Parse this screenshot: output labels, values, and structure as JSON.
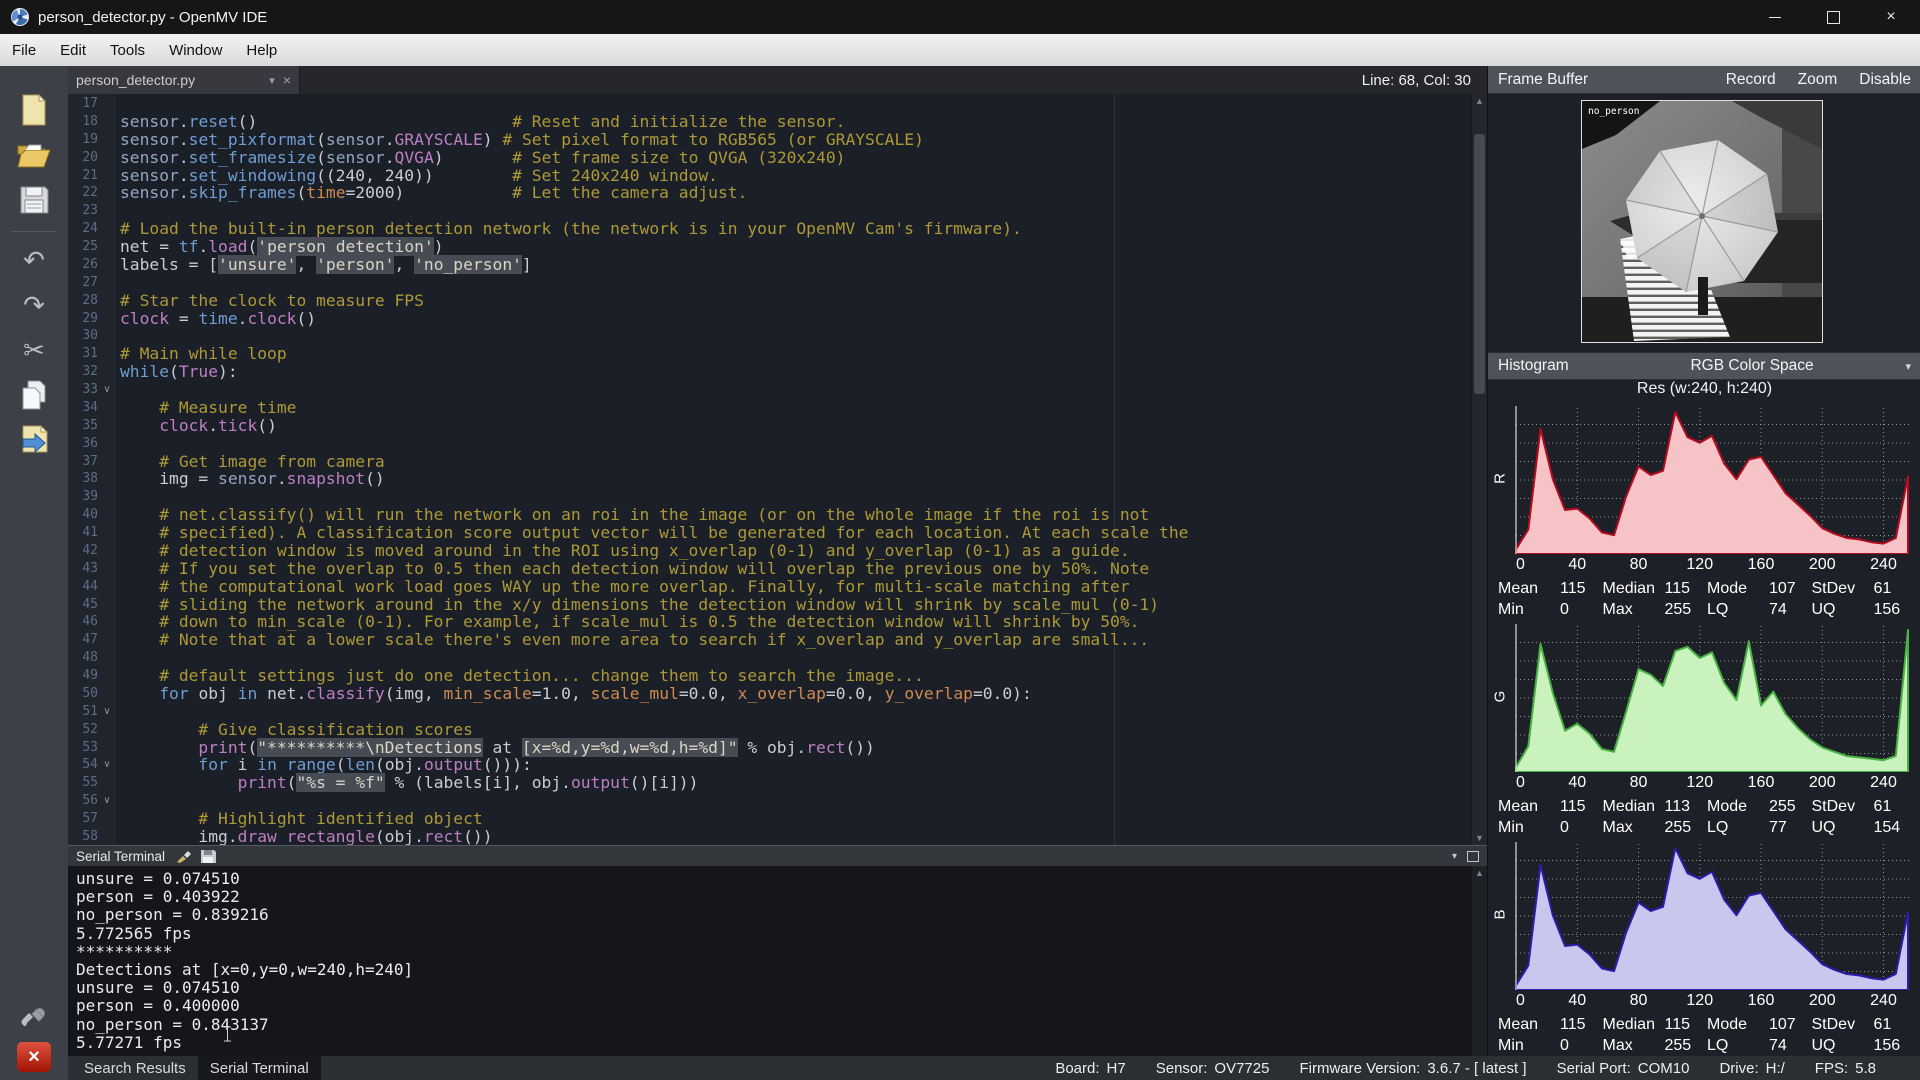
{
  "window": {
    "title": "person_detector.py - OpenMV IDE"
  },
  "menu": {
    "items": [
      "File",
      "Edit",
      "Tools",
      "Window",
      "Help"
    ]
  },
  "icons": {
    "close": "×",
    "dropdown": "▾",
    "undo": "↶",
    "redo": "↷",
    "cut": "✂",
    "scroll_up": "▲",
    "scroll_down": "▼",
    "fold": "∨",
    "collapse": "▾"
  },
  "editor": {
    "tab": {
      "label": "person_detector.py"
    },
    "cursor_status": "Line: 68, Col: 30",
    "lines": [
      {
        "n": 17,
        "seg": []
      },
      {
        "n": 18,
        "seg": [
          [
            "mod",
            "sensor"
          ],
          [
            "p",
            "."
          ],
          [
            "kb",
            "reset"
          ],
          [
            "p",
            "()                          "
          ],
          [
            "c",
            "# Reset and initialize the sensor."
          ]
        ]
      },
      {
        "n": 19,
        "seg": [
          [
            "mod",
            "sensor"
          ],
          [
            "p",
            "."
          ],
          [
            "kb",
            "set_pixformat"
          ],
          [
            "p",
            "("
          ],
          [
            "mod",
            "sensor"
          ],
          [
            "p",
            "."
          ],
          [
            "km",
            "GRAYSCALE"
          ],
          [
            "p",
            ") "
          ],
          [
            "c",
            "# Set pixel format to RGB565 (or GRAYSCALE)"
          ]
        ]
      },
      {
        "n": 20,
        "seg": [
          [
            "mod",
            "sensor"
          ],
          [
            "p",
            "."
          ],
          [
            "kb",
            "set_framesize"
          ],
          [
            "p",
            "("
          ],
          [
            "mod",
            "sensor"
          ],
          [
            "p",
            "."
          ],
          [
            "km",
            "QVGA"
          ],
          [
            "p",
            ")       "
          ],
          [
            "c",
            "# Set frame size to QVGA (320x240)"
          ]
        ]
      },
      {
        "n": 21,
        "seg": [
          [
            "mod",
            "sensor"
          ],
          [
            "p",
            "."
          ],
          [
            "kb",
            "set_windowing"
          ],
          [
            "p",
            "((240, 240))        "
          ],
          [
            "c",
            "# Set 240x240 window."
          ]
        ]
      },
      {
        "n": 22,
        "seg": [
          [
            "mod",
            "sensor"
          ],
          [
            "p",
            "."
          ],
          [
            "kb",
            "skip_frames"
          ],
          [
            "p",
            "("
          ],
          [
            "kw",
            "time"
          ],
          [
            "p",
            "=2000)           "
          ],
          [
            "c",
            "# Let the camera adjust."
          ]
        ]
      },
      {
        "n": 23,
        "seg": []
      },
      {
        "n": 24,
        "seg": [
          [
            "c",
            "# Load the built-in person detection network (the network is in your OpenMV Cam's firmware)."
          ]
        ]
      },
      {
        "n": 25,
        "seg": [
          [
            "p",
            "net = "
          ],
          [
            "kb",
            "tf"
          ],
          [
            "p",
            "."
          ],
          [
            "km",
            "load"
          ],
          [
            "p",
            "("
          ],
          [
            "s",
            "'person_detection'"
          ],
          [
            "p",
            ")"
          ]
        ]
      },
      {
        "n": 26,
        "seg": [
          [
            "p",
            "labels = ["
          ],
          [
            "s",
            "'unsure'"
          ],
          [
            "p",
            ", "
          ],
          [
            "s",
            "'person'"
          ],
          [
            "p",
            ", "
          ],
          [
            "s",
            "'no_person'"
          ],
          [
            "p",
            "]"
          ]
        ]
      },
      {
        "n": 27,
        "seg": []
      },
      {
        "n": 28,
        "seg": [
          [
            "c",
            "# Star the clock to measure FPS"
          ]
        ]
      },
      {
        "n": 29,
        "seg": [
          [
            "km",
            "clock"
          ],
          [
            "p",
            " = "
          ],
          [
            "kb",
            "time"
          ],
          [
            "p",
            "."
          ],
          [
            "km",
            "clock"
          ],
          [
            "p",
            "()"
          ]
        ]
      },
      {
        "n": 30,
        "seg": []
      },
      {
        "n": 31,
        "seg": [
          [
            "c",
            "# Main while loop"
          ]
        ]
      },
      {
        "n": 32,
        "seg": [
          [
            "kb",
            "while"
          ],
          [
            "p",
            "("
          ],
          [
            "km",
            "True"
          ],
          [
            "p",
            "):"
          ]
        ]
      },
      {
        "n": 33,
        "fold": true,
        "seg": []
      },
      {
        "n": 34,
        "seg": [
          [
            "p",
            "    "
          ],
          [
            "c",
            "# Measure time"
          ]
        ]
      },
      {
        "n": 35,
        "seg": [
          [
            "p",
            "    "
          ],
          [
            "km",
            "clock"
          ],
          [
            "p",
            "."
          ],
          [
            "km",
            "tick"
          ],
          [
            "p",
            "()"
          ]
        ]
      },
      {
        "n": 36,
        "seg": []
      },
      {
        "n": 37,
        "seg": [
          [
            "p",
            "    "
          ],
          [
            "c",
            "# Get image from camera"
          ]
        ]
      },
      {
        "n": 38,
        "seg": [
          [
            "p",
            "    img = "
          ],
          [
            "mod",
            "sensor"
          ],
          [
            "p",
            "."
          ],
          [
            "km",
            "snapshot"
          ],
          [
            "p",
            "()"
          ]
        ]
      },
      {
        "n": 39,
        "seg": []
      },
      {
        "n": 40,
        "seg": [
          [
            "p",
            "    "
          ],
          [
            "c",
            "# net.classify() will run the network on an roi in the image (or on the whole image if the roi is not"
          ]
        ]
      },
      {
        "n": 41,
        "seg": [
          [
            "p",
            "    "
          ],
          [
            "c",
            "# specified). A classification score output vector will be generated for each location. At each scale the"
          ]
        ]
      },
      {
        "n": 42,
        "seg": [
          [
            "p",
            "    "
          ],
          [
            "c",
            "# detection window is moved around in the ROI using x_overlap (0-1) and y_overlap (0-1) as a guide."
          ]
        ]
      },
      {
        "n": 43,
        "seg": [
          [
            "p",
            "    "
          ],
          [
            "c",
            "# If you set the overlap to 0.5 then each detection window will overlap the previous one by 50%. Note"
          ]
        ]
      },
      {
        "n": 44,
        "seg": [
          [
            "p",
            "    "
          ],
          [
            "c",
            "# the computational work load goes WAY up the more overlap. Finally, for multi-scale matching after"
          ]
        ]
      },
      {
        "n": 45,
        "seg": [
          [
            "p",
            "    "
          ],
          [
            "c",
            "# sliding the network around in the x/y dimensions the detection window will shrink by scale_mul (0-1)"
          ]
        ]
      },
      {
        "n": 46,
        "seg": [
          [
            "p",
            "    "
          ],
          [
            "c",
            "# down to min_scale (0-1). For example, if scale_mul is 0.5 the detection window will shrink by 50%."
          ]
        ]
      },
      {
        "n": 47,
        "seg": [
          [
            "p",
            "    "
          ],
          [
            "c",
            "# Note that at a lower scale there's even more area to search if x_overlap and y_overlap are small..."
          ]
        ]
      },
      {
        "n": 48,
        "seg": []
      },
      {
        "n": 49,
        "seg": [
          [
            "p",
            "    "
          ],
          [
            "c",
            "# default settings just do one detection... change them to search the image..."
          ]
        ]
      },
      {
        "n": 50,
        "seg": [
          [
            "p",
            "    "
          ],
          [
            "kb",
            "for"
          ],
          [
            "p",
            " obj "
          ],
          [
            "kb",
            "in"
          ],
          [
            "p",
            " net."
          ],
          [
            "km",
            "classify"
          ],
          [
            "p",
            "(img, "
          ],
          [
            "kw",
            "min_scale"
          ],
          [
            "p",
            "=1.0, "
          ],
          [
            "kw",
            "scale_mul"
          ],
          [
            "p",
            "=0.0, "
          ],
          [
            "kw",
            "x_overlap"
          ],
          [
            "p",
            "=0.0, "
          ],
          [
            "kw",
            "y_overlap"
          ],
          [
            "p",
            "=0.0):"
          ]
        ]
      },
      {
        "n": 51,
        "fold": true,
        "seg": []
      },
      {
        "n": 52,
        "seg": [
          [
            "p",
            "        "
          ],
          [
            "c",
            "# Give classification scores"
          ]
        ]
      },
      {
        "n": 53,
        "seg": [
          [
            "p",
            "        "
          ],
          [
            "km",
            "print"
          ],
          [
            "p",
            "("
          ],
          [
            "s",
            "\"**********\\nDetections"
          ],
          [
            "p",
            " at "
          ],
          [
            "s",
            "[x=%d,y=%d,w=%d,h=%d]\""
          ],
          [
            "p",
            " % obj."
          ],
          [
            "km",
            "rect"
          ],
          [
            "p",
            "())"
          ]
        ]
      },
      {
        "n": 54,
        "fold": true,
        "seg": [
          [
            "p",
            "        "
          ],
          [
            "kb",
            "for"
          ],
          [
            "p",
            " i "
          ],
          [
            "kb",
            "in"
          ],
          [
            "p",
            " "
          ],
          [
            "kb",
            "range"
          ],
          [
            "p",
            "("
          ],
          [
            "kb",
            "len"
          ],
          [
            "p",
            "(obj."
          ],
          [
            "km",
            "output"
          ],
          [
            "p",
            "())):"
          ]
        ]
      },
      {
        "n": 55,
        "seg": [
          [
            "p",
            "            "
          ],
          [
            "km",
            "print"
          ],
          [
            "p",
            "("
          ],
          [
            "s",
            "\"%s = %f\""
          ],
          [
            "p",
            " % (labels[i], obj."
          ],
          [
            "km",
            "output"
          ],
          [
            "p",
            "()[i]))"
          ]
        ]
      },
      {
        "n": 56,
        "fold": true,
        "seg": []
      },
      {
        "n": 57,
        "seg": [
          [
            "p",
            "        "
          ],
          [
            "c",
            "# Highlight identified object"
          ]
        ]
      },
      {
        "n": 58,
        "seg": [
          [
            "p",
            "        img."
          ],
          [
            "km",
            "draw_rectangle"
          ],
          [
            "p",
            "(obj."
          ],
          [
            "km",
            "rect"
          ],
          [
            "p",
            "())"
          ]
        ]
      }
    ]
  },
  "terminal": {
    "title": "Serial Terminal",
    "lines": [
      "unsure = 0.074510",
      "person = 0.403922",
      "no_person = 0.839216",
      "5.772565 fps",
      "**********",
      "Detections at [x=0,y=0,w=240,h=240]",
      "unsure = 0.074510",
      "person = 0.400000",
      "no_person = 0.843137",
      "5.77271 fps"
    ]
  },
  "status_bar": {
    "tabs": [
      "Search Results",
      "Serial Terminal"
    ],
    "active_tab": 1,
    "fields": [
      {
        "label": "Board:",
        "value": "H7"
      },
      {
        "label": "Sensor:",
        "value": "OV7725"
      },
      {
        "label": "Firmware Version:",
        "value": "3.6.7 - [ latest ]"
      },
      {
        "label": "Serial Port:",
        "value": "COM10"
      },
      {
        "label": "Drive:",
        "value": "H:/"
      },
      {
        "label": "FPS:",
        "value": "5.8"
      }
    ]
  },
  "frame_buffer": {
    "title": "Frame Buffer",
    "actions": [
      "Record",
      "Zoom",
      "Disable"
    ],
    "overlay_label": "no_person"
  },
  "histogram": {
    "title": "Histogram",
    "color_space": "RGB Color Space",
    "res_label": "Res (w:240, h:240)"
  },
  "chart_data": [
    {
      "type": "area",
      "channel": "R",
      "xlim": [
        0,
        255
      ],
      "ylim": [
        0,
        1
      ],
      "grid": "dotted",
      "ticks": [
        0,
        40,
        80,
        120,
        160,
        200,
        240
      ],
      "fill": "#f6c4c6",
      "stroke": "#b50b1e",
      "values_norm": [
        0.02,
        0.16,
        0.88,
        0.52,
        0.3,
        0.31,
        0.24,
        0.14,
        0.12,
        0.4,
        0.61,
        0.55,
        0.58,
        1.0,
        0.82,
        0.78,
        0.83,
        0.63,
        0.52,
        0.66,
        0.68,
        0.55,
        0.42,
        0.34,
        0.26,
        0.17,
        0.13,
        0.1,
        0.09,
        0.07,
        0.06,
        0.1,
        0.54
      ],
      "stats": [
        [
          "Mean",
          "115"
        ],
        [
          "Median",
          "115"
        ],
        [
          "Mode",
          "107"
        ],
        [
          "StDev",
          "61"
        ],
        [
          "Min",
          "0"
        ],
        [
          "Max",
          "255"
        ],
        [
          "LQ",
          "74"
        ],
        [
          "UQ",
          "156"
        ]
      ]
    },
    {
      "type": "area",
      "channel": "G",
      "xlim": [
        0,
        255
      ],
      "ylim": [
        0,
        1
      ],
      "grid": "dotted",
      "ticks": [
        0,
        40,
        80,
        120,
        160,
        200,
        240
      ],
      "fill": "#c9f2bd",
      "stroke": "#49b045",
      "values_norm": [
        0.02,
        0.17,
        0.9,
        0.55,
        0.28,
        0.33,
        0.26,
        0.15,
        0.13,
        0.42,
        0.72,
        0.68,
        0.6,
        0.85,
        0.88,
        0.8,
        0.84,
        0.62,
        0.5,
        0.92,
        0.46,
        0.56,
        0.4,
        0.3,
        0.22,
        0.16,
        0.13,
        0.1,
        0.09,
        0.08,
        0.07,
        0.1,
        1.0
      ],
      "stats": [
        [
          "Mean",
          "115"
        ],
        [
          "Median",
          "113"
        ],
        [
          "Mode",
          "255"
        ],
        [
          "StDev",
          "61"
        ],
        [
          "Min",
          "0"
        ],
        [
          "Max",
          "255"
        ],
        [
          "LQ",
          "77"
        ],
        [
          "UQ",
          "154"
        ]
      ]
    },
    {
      "type": "area",
      "channel": "B",
      "xlim": [
        0,
        255
      ],
      "ylim": [
        0,
        1
      ],
      "grid": "dotted",
      "ticks": [
        0,
        40,
        80,
        120,
        160,
        200,
        240
      ],
      "fill": "#c9c7ee",
      "stroke": "#2b1cab",
      "values_norm": [
        0.02,
        0.16,
        0.88,
        0.52,
        0.3,
        0.31,
        0.24,
        0.14,
        0.12,
        0.4,
        0.61,
        0.55,
        0.58,
        1.0,
        0.82,
        0.78,
        0.83,
        0.63,
        0.52,
        0.66,
        0.68,
        0.55,
        0.42,
        0.34,
        0.26,
        0.17,
        0.13,
        0.1,
        0.09,
        0.07,
        0.06,
        0.1,
        0.54
      ],
      "stats": [
        [
          "Mean",
          "115"
        ],
        [
          "Median",
          "115"
        ],
        [
          "Mode",
          "107"
        ],
        [
          "StDev",
          "61"
        ],
        [
          "Min",
          "0"
        ],
        [
          "Max",
          "255"
        ],
        [
          "LQ",
          "74"
        ],
        [
          "UQ",
          "156"
        ]
      ]
    }
  ]
}
